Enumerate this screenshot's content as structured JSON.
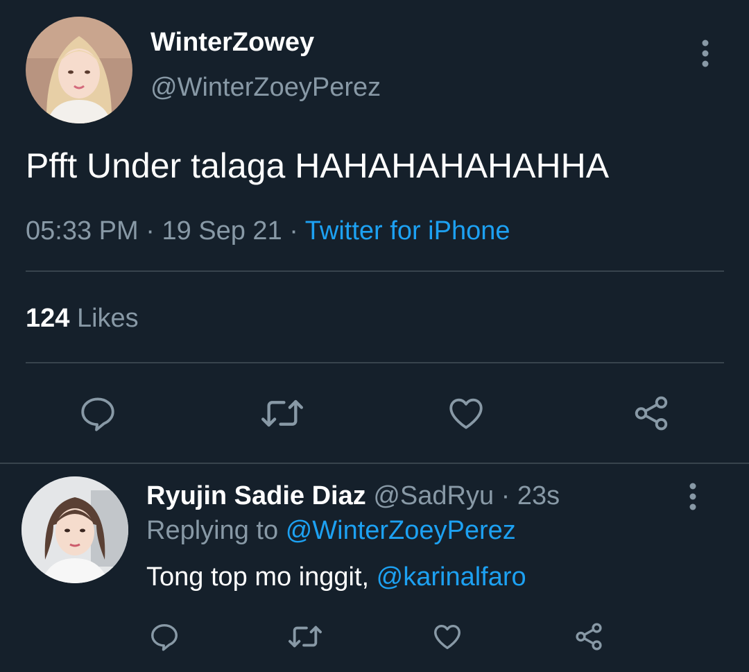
{
  "tweet": {
    "display_name": "WinterZowey",
    "handle": "@WinterZoeyPerez",
    "text": "Pfft Under talaga HAHAHAHAHAHHA",
    "time": "05:33 PM",
    "date": "19 Sep 21",
    "separator": "·",
    "source": "Twitter for iPhone",
    "likes_count": "124",
    "likes_label": "Likes",
    "actions": [
      "reply-icon",
      "retweet-icon",
      "like-icon",
      "share-icon"
    ]
  },
  "reply": {
    "display_name": "Ryujin Sadie Diaz",
    "handle": "@SadRyu",
    "separator": "·",
    "time": "23s",
    "replying_label": "Replying to",
    "replying_to": "@WinterZoeyPerez",
    "text": "Tong top mo inggit, ",
    "mention": "@karinalfaro",
    "actions": [
      "reply-icon",
      "retweet-icon",
      "like-icon",
      "share-icon"
    ]
  },
  "colors": {
    "background": "#15202b",
    "primary_text": "#ffffff",
    "secondary_text": "#8899a6",
    "accent": "#1da1f2",
    "divider": "#38444d"
  }
}
